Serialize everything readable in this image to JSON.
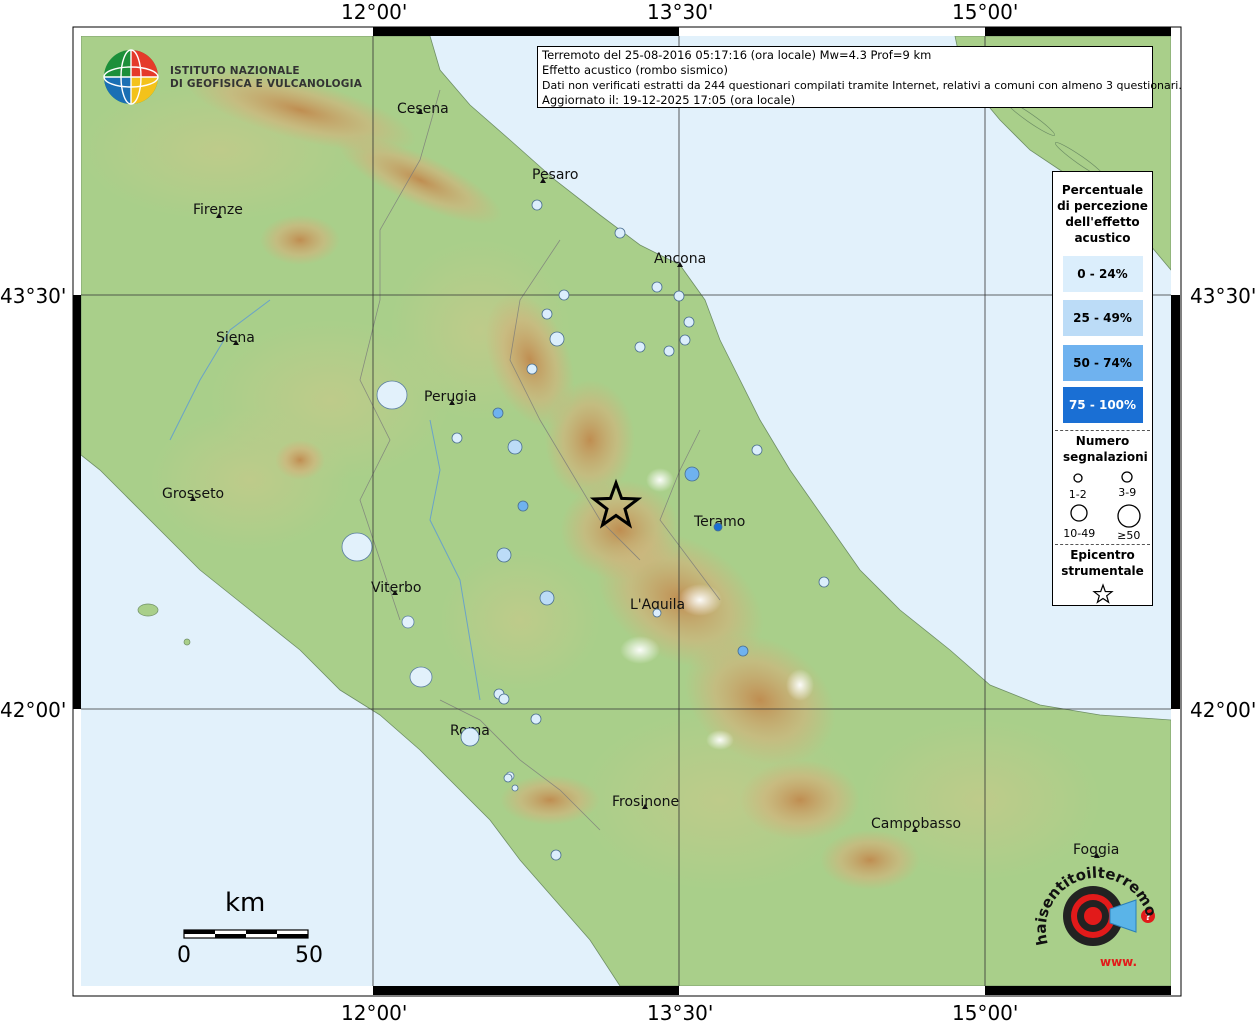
{
  "map": {
    "longitude_labels": [
      "12°00'",
      "13°30'",
      "15°00'"
    ],
    "latitude_labels": [
      "43°30'",
      "42°00'"
    ],
    "cities": [
      {
        "name": "Cesena"
      },
      {
        "name": "Pesaro"
      },
      {
        "name": "Firenze"
      },
      {
        "name": "Ancona"
      },
      {
        "name": "Siena"
      },
      {
        "name": "Perugia"
      },
      {
        "name": "Grosseto"
      },
      {
        "name": "Teramo"
      },
      {
        "name": "Viterbo"
      },
      {
        "name": "L'Aquila"
      },
      {
        "name": "Roma"
      },
      {
        "name": "Frosinone"
      },
      {
        "name": "Campobasso"
      },
      {
        "name": "Foggia"
      }
    ],
    "epicenter": {
      "symbol": "star"
    },
    "colors": {
      "sea": "#e2f1fb",
      "land": "#a9cf8a",
      "mountain": "#c9a067",
      "class0": "#dbeefc",
      "class1": "#bcdcf7",
      "class2": "#6fb2ef",
      "class3": "#1a6fd4"
    }
  },
  "info_box": {
    "line1": "Terremoto del 25-08-2016 05:17:16 (ora locale) Mw=4.3 Prof=9 km",
    "line2": "Effetto acustico (rombo sismico)",
    "line3": "Dati non verificati estratti da 244 questionari compilati tramite Internet, relativi a comuni con almeno 3 questionari.",
    "line4": "Aggiornato il: 19-12-2025 17:05 (ora locale)"
  },
  "legend": {
    "title": "Percentuale di percezione dell'effetto acustico",
    "classes": [
      {
        "label": "0 - 24%"
      },
      {
        "label": "25 - 49%"
      },
      {
        "label": "50 - 74%"
      },
      {
        "label": "75 - 100%"
      }
    ],
    "count_title": "Numero segnalazioni",
    "sizes": [
      "1-2",
      "3-9",
      "10-49",
      "≥50"
    ],
    "epicenter_title": "Epicentro strumentale"
  },
  "scale": {
    "unit": "km",
    "min": "0",
    "max": "50"
  },
  "logo_ingv": {
    "line1": "ISTITUTO NAZIONALE",
    "line2": "DI GEOFISICA E VULCANOLOGIA"
  },
  "logo_hsit": {
    "text": "haisentitoilterremoto.it",
    "prefix": "www."
  }
}
